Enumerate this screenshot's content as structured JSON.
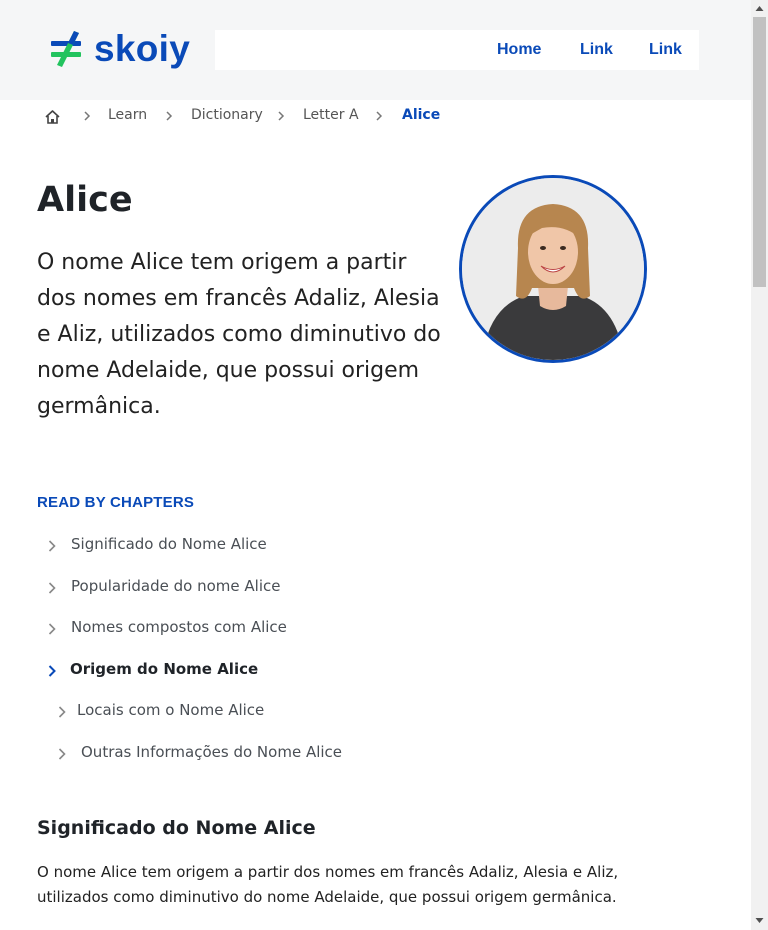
{
  "brand": {
    "name": "skoiy",
    "colors": {
      "primary": "#0a4ab8",
      "accent": "#22c35e"
    }
  },
  "nav": {
    "links": [
      "Home",
      "Link",
      "Link"
    ]
  },
  "breadcrumb": {
    "home_icon": "home-icon",
    "items": [
      "Learn",
      "Dictionary",
      "Letter A"
    ],
    "current": "Alice"
  },
  "page": {
    "title": "Alice",
    "intro": "O nome Alice tem origem a partir dos nomes em francês Adaliz, Alesia e Aliz, utilizados como diminutivo do nome Adelaide, que possui origem germânica.",
    "avatar": "portrait-photo"
  },
  "chapters": {
    "heading": "READ BY CHAPTERS",
    "items": [
      "Significado do Nome Alice",
      "Popularidade do nome Alice",
      "Nomes compostos com Alice",
      "Origem do Nome Alice",
      "Locais com o Nome Alice",
      "Outras Informações do Nome Alice"
    ],
    "active_index": 3
  },
  "section": {
    "title": "Significado do Nome Alice",
    "text": "O nome Alice tem origem a partir dos nomes em francês Adaliz, Alesia e Aliz, utilizados como diminutivo do nome Adelaide, que possui origem germânica."
  }
}
